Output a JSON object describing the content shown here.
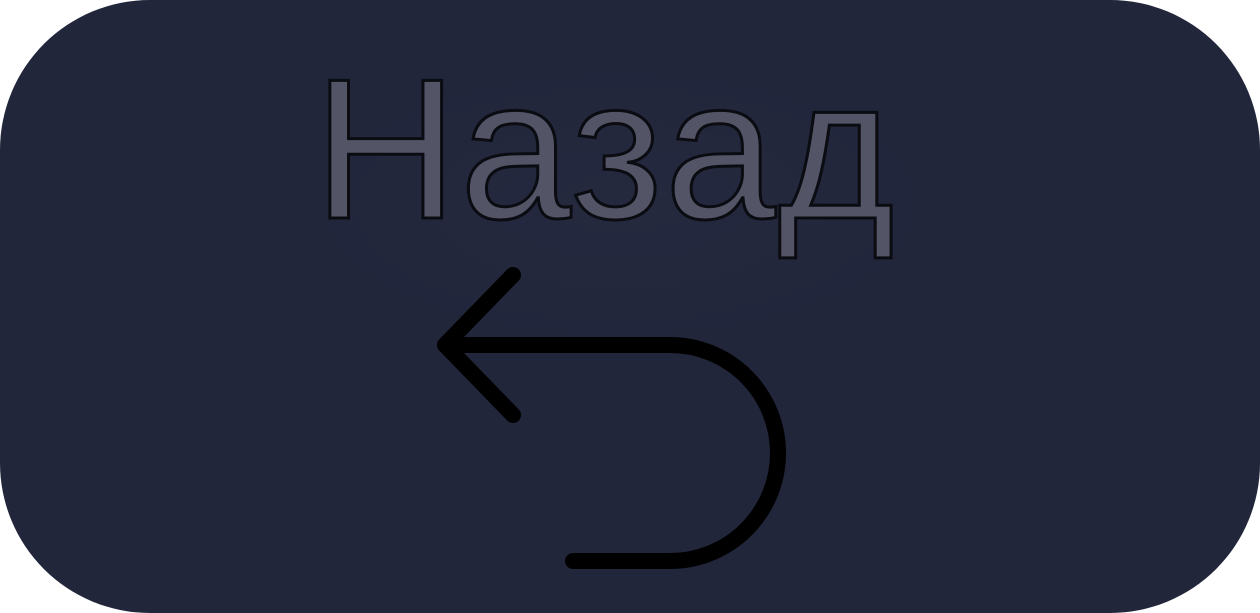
{
  "button": {
    "label": "Назад",
    "icon": "back-arrow-icon"
  },
  "colors": {
    "background": "#22263b",
    "label": "#535567",
    "label_outline": "#0b0c12",
    "icon": "#000000"
  }
}
